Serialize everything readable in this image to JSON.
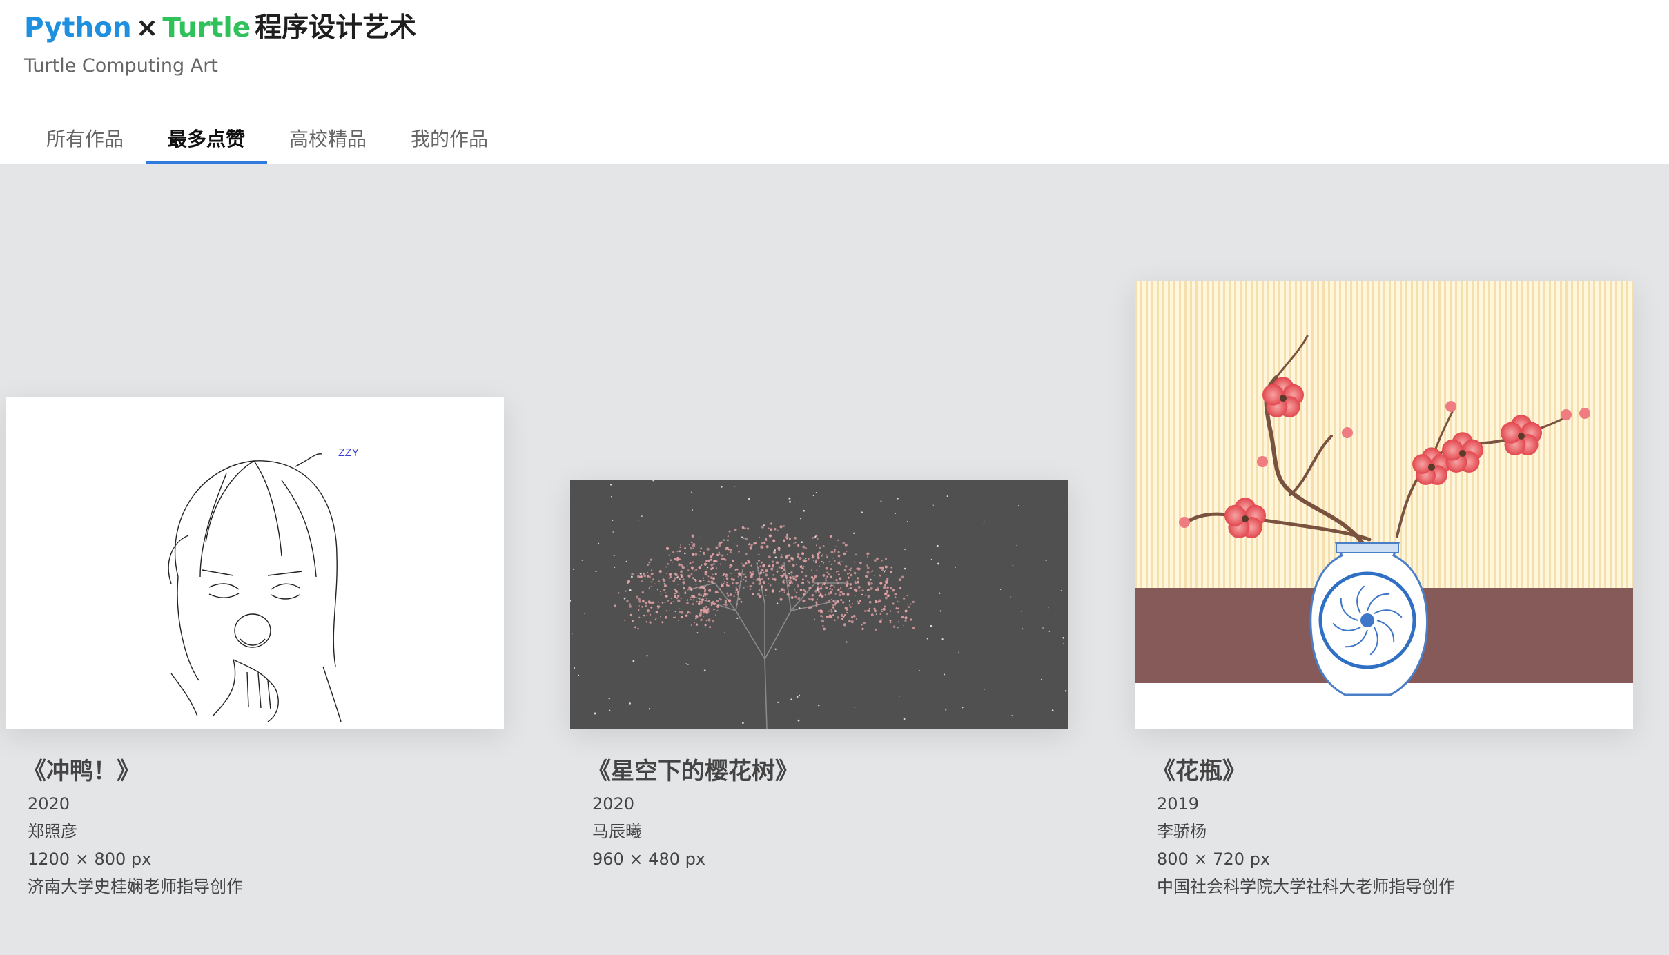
{
  "header": {
    "title_python": "Python",
    "title_x": "×",
    "title_turtle": "Turtle",
    "title_rest": "程序设计艺术",
    "subtitle": "Turtle Computing Art",
    "colors": {
      "python": "#1f8fe0",
      "turtle": "#2fc25b",
      "tab_indicator": "#2f7be0"
    }
  },
  "tabs": [
    {
      "label": "所有作品",
      "active": false
    },
    {
      "label": "最多点赞",
      "active": true
    },
    {
      "label": "高校精品",
      "active": false
    },
    {
      "label": "我的作品",
      "active": false
    }
  ],
  "works": [
    {
      "title": "《冲鸭！》",
      "year": "2020",
      "author": "郑照彦",
      "size": "1200 × 800 px",
      "note": "济南大学史桂娴老师指导创作",
      "image_label": "ZZY"
    },
    {
      "title": "《星空下的樱花树》",
      "year": "2020",
      "author": "马辰曦",
      "size": "960 × 480 px",
      "note": ""
    },
    {
      "title": "《花瓶》",
      "year": "2019",
      "author": "李骄杨",
      "size": "800 × 720 px",
      "note": "中国社会科学院大学社科大老师指导创作"
    }
  ]
}
